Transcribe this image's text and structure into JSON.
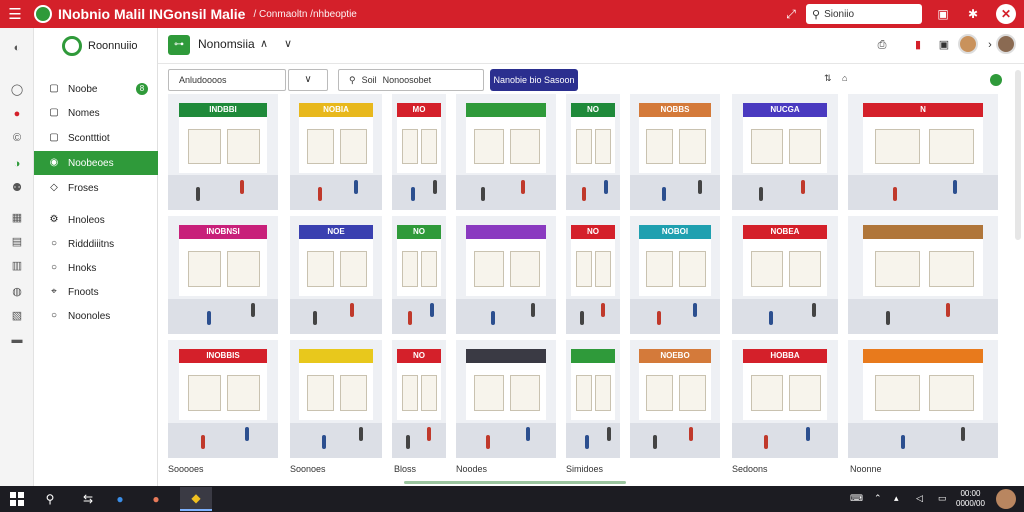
{
  "titlebar": {
    "title": "INobnio Malil INGonsil Malie",
    "subtitle": "/ Conmaoltn /nhbeoptie",
    "search_placeholder": "Sioniio",
    "accent": "#d4202a"
  },
  "sidebar": {
    "brand": "Roonnuiio",
    "items": [
      {
        "label": "Noobe",
        "icon": "file-icon",
        "badge": "8"
      },
      {
        "label": "Nomes",
        "icon": "file-icon"
      },
      {
        "label": "Scontttiot",
        "icon": "file-icon"
      },
      {
        "label": "Noobeoes",
        "icon": "circle-icon",
        "active": true
      },
      {
        "label": "Froses",
        "icon": "shield-icon"
      },
      {
        "label": "Hnoleos",
        "icon": "gear-icon"
      },
      {
        "label": "Ridddiiitns",
        "icon": "circle-icon"
      },
      {
        "label": "Hnoks",
        "icon": "circle-icon"
      },
      {
        "label": "Fnoots",
        "icon": "pin-icon"
      },
      {
        "label": "Noonoles",
        "icon": "circle-icon"
      }
    ]
  },
  "header": {
    "title": "Nonomsiia"
  },
  "toolbar": {
    "filter_value": "Anludoooos",
    "search_label": "Soil",
    "search_value": "Nonoosobet",
    "primary_label": "Nanobie bio Sasoon"
  },
  "grid": {
    "captions": [
      "Sooooes",
      "Soonoes",
      "Bloss",
      "Noodes",
      "Simidoes",
      "Sedoons",
      "Noonne"
    ]
  },
  "tiles": [
    {
      "sign": "INDBBI",
      "color": "#1f8a3a"
    },
    {
      "sign": "NOBIA",
      "color": "#e8b81c"
    },
    {
      "sign": "MO",
      "color": "#d4202a"
    },
    {
      "sign": "",
      "color": "#2f9a3a"
    },
    {
      "sign": "NO",
      "color": "#1f8a3a"
    },
    {
      "sign": "NOBBS",
      "color": "#d47a3a"
    },
    {
      "sign": "NUCGA",
      "color": "#4a3ac0"
    },
    {
      "sign": "N",
      "color": "#d4202a"
    },
    {
      "sign": "INOBNSI",
      "color": "#c8207a"
    },
    {
      "sign": "NOE",
      "color": "#3a40b0"
    },
    {
      "sign": "NO",
      "color": "#2f9a3a"
    },
    {
      "sign": "",
      "color": "#8a3ac0"
    },
    {
      "sign": "NO",
      "color": "#d4202a"
    },
    {
      "sign": "NOBOI",
      "color": "#1fa0b0"
    },
    {
      "sign": "NOBEA",
      "color": "#d4202a"
    },
    {
      "sign": "",
      "color": "#b0763a"
    },
    {
      "sign": "INOBBIS",
      "color": "#d4202a"
    },
    {
      "sign": "",
      "color": "#e8c81c"
    },
    {
      "sign": "NO",
      "color": "#d4202a"
    },
    {
      "sign": "",
      "color": "#3a3a44"
    },
    {
      "sign": "",
      "color": "#2f9a3a"
    },
    {
      "sign": "NOEBO",
      "color": "#d47a3a"
    },
    {
      "sign": "HOBBA",
      "color": "#d4202a"
    },
    {
      "sign": "",
      "color": "#e87a1c"
    }
  ],
  "taskbar": {
    "time": "00:00",
    "date": "0000/00"
  }
}
